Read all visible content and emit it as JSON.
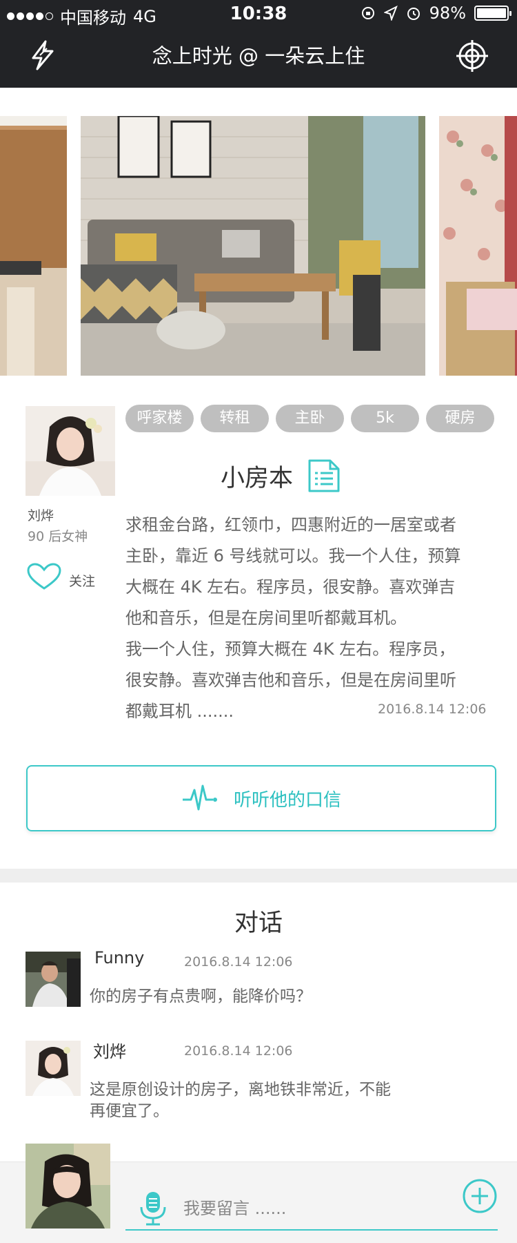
{
  "status": {
    "carrier": "中国移动",
    "network": "4G",
    "time": "10:38",
    "battery": "98%"
  },
  "nav": {
    "title": "念上时光 @ 一朵云上住",
    "left_icon": "flash-icon",
    "right_icon": "target-icon"
  },
  "post": {
    "user": {
      "name": "刘烨",
      "tag": "90 后女神"
    },
    "follow_label": "关注",
    "tags": [
      "呼家楼",
      "转租",
      "主卧",
      "5k",
      "硬房"
    ],
    "title": "小房本",
    "description_lines": [
      "求租金台路，红领巾，四惠附近的一居室或者",
      "主卧，靠近 6 号线就可以。我一个人住，预算",
      "大概在 4K 左右。程序员，很安静。喜欢弹吉",
      "他和音乐，但是在房间里听都戴耳机。",
      "我一个人住，预算大概在 4K 左右。程序员，",
      "很安静。喜欢弹吉他和音乐，但是在房间里听",
      "都戴耳机 ......."
    ],
    "time": "2016.8.14 12:06",
    "voice_button": "听听他的口信"
  },
  "conversation": {
    "title": "对话",
    "messages": [
      {
        "name": "Funny",
        "time": "2016.8.14 12:06",
        "text_lines": [
          "你的房子有点贵啊，能降价吗？"
        ]
      },
      {
        "name": "刘烨",
        "time": "2016.8.14 12:06",
        "text_lines": [
          "这是原创设计的房子，离地铁非常近，不能",
          "再便宜了。"
        ]
      }
    ]
  },
  "input": {
    "placeholder": "我要留言 ......"
  },
  "colors": {
    "accent": "#3cc8c8",
    "nav_bg": "#222326",
    "tag_bg": "#bfbfbf"
  }
}
